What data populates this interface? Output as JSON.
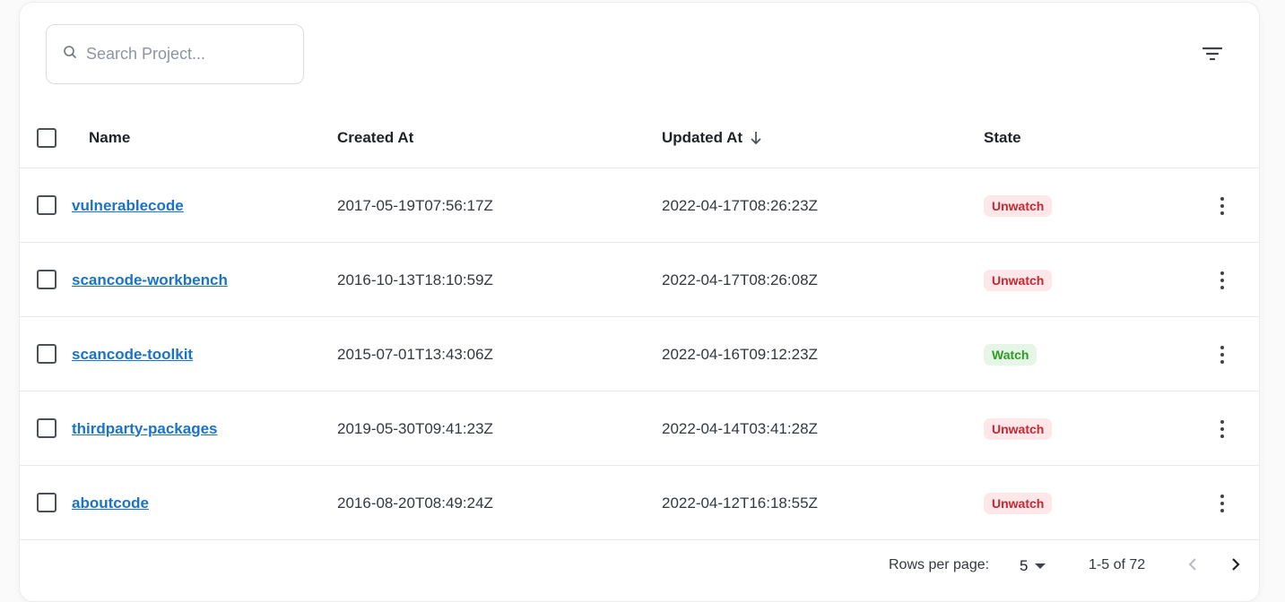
{
  "search": {
    "placeholder": "Search Project...",
    "value": ""
  },
  "table": {
    "headers": {
      "name": "Name",
      "created_at": "Created At",
      "updated_at": "Updated At",
      "state": "State"
    },
    "sort": {
      "column": "updated_at",
      "direction": "desc"
    },
    "rows": [
      {
        "name": "vulnerablecode",
        "created_at": "2017-05-19T07:56:17Z",
        "updated_at": "2022-04-17T08:26:23Z",
        "state": "Unwatch"
      },
      {
        "name": "scancode-workbench",
        "created_at": "2016-10-13T18:10:59Z",
        "updated_at": "2022-04-17T08:26:08Z",
        "state": "Unwatch"
      },
      {
        "name": "scancode-toolkit",
        "created_at": "2015-07-01T13:43:06Z",
        "updated_at": "2022-04-16T09:12:23Z",
        "state": "Watch"
      },
      {
        "name": "thirdparty-packages",
        "created_at": "2019-05-30T09:41:23Z",
        "updated_at": "2022-04-14T03:41:28Z",
        "state": "Unwatch"
      },
      {
        "name": "aboutcode",
        "created_at": "2016-08-20T08:49:24Z",
        "updated_at": "2022-04-12T16:18:55Z",
        "state": "Unwatch"
      }
    ]
  },
  "pagination": {
    "rows_per_page_label": "Rows per page:",
    "rows_per_page": "5",
    "range": "1-5 of 72"
  },
  "colors": {
    "link": "#1a73c8",
    "unwatch_bg": "#fde7e9",
    "unwatch_text": "#c62833",
    "watch_bg": "#e6f6e6",
    "watch_text": "#2c9b22"
  },
  "icons": [
    "search-icon",
    "filter-icon",
    "sort-arrow-down-icon",
    "more-vert-icon",
    "chevron-left-icon",
    "chevron-right-icon",
    "dropdown-caret-icon"
  ]
}
